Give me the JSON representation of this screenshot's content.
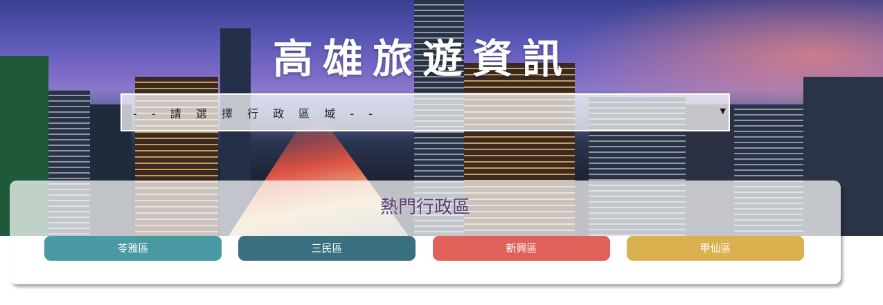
{
  "header": {
    "title": "高雄旅遊資訊"
  },
  "district_select": {
    "selected": "- - 請 選 擇 行 政 區 域 - -",
    "arrow_icon": "caret-down-icon"
  },
  "hot_districts": {
    "title": "熱門行政區",
    "buttons": [
      {
        "label": "苓雅區",
        "color": "#4a9aa3"
      },
      {
        "label": "三民區",
        "color": "#3a6f80"
      },
      {
        "label": "新興區",
        "color": "#e0605a"
      },
      {
        "label": "甲仙區",
        "color": "#dbb04e"
      }
    ]
  },
  "colors": {
    "panel_title": "#5a3f75"
  }
}
